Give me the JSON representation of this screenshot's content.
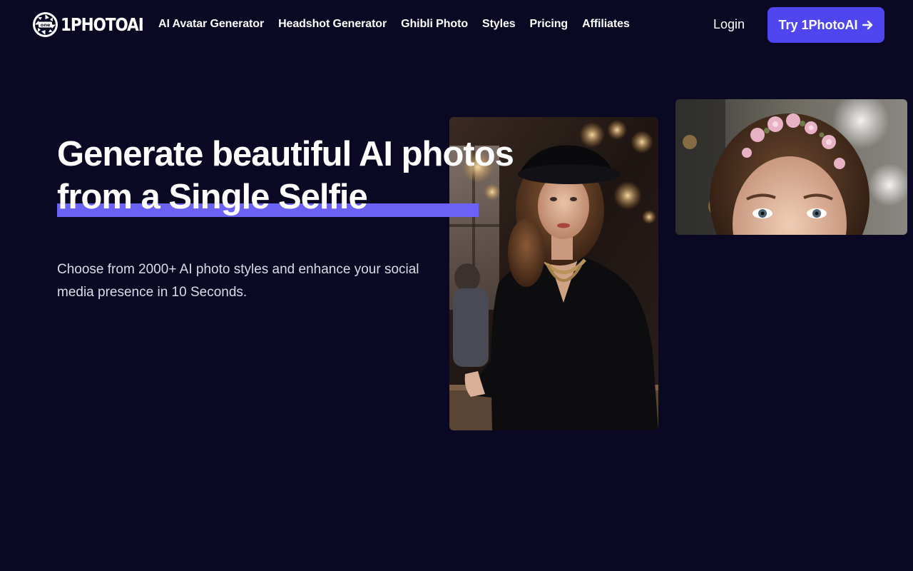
{
  "nav": {
    "logo_text": "1PHOTOAI",
    "logo_badge": "one",
    "links": [
      "AI Avatar Generator",
      "Headshot Generator",
      "Ghibli Photo",
      "Styles",
      "Pricing",
      "Affiliates"
    ],
    "login_label": "Login",
    "cta_label": "Try 1PhotoAI",
    "cta_icon": "arrow-right-icon"
  },
  "hero": {
    "headline_line1": "Generate beautiful AI photos",
    "headline_line2": "from a Single Selfie",
    "subtitle": "Choose from 2000+ AI photo styles and enhance your social media presence in 10 Seconds."
  },
  "colors": {
    "background": "#0a0822",
    "accent": "#4f46ef",
    "underline": "#6b61f4"
  }
}
